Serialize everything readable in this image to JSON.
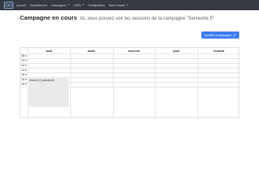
{
  "nav": {
    "logo": "logo-icon",
    "items": [
      {
        "label": "Accueil",
        "dropdown": false
      },
      {
        "label": "Compétences",
        "dropdown": false
      },
      {
        "label": "Campagnes",
        "dropdown": true
      },
      {
        "label": "UFRs",
        "dropdown": true
      },
      {
        "label": "Configuration",
        "dropdown": false
      },
      {
        "label": "Mon Compte",
        "dropdown": true
      }
    ]
  },
  "header": {
    "title": "Campagne en cours",
    "subtitle": "Ici, vous pouvez voir les sessions de la campagne \"Semestre 5\""
  },
  "edit_button": {
    "label": "Modifier la campagne",
    "icon": "pencil-icon"
  },
  "schedule": {
    "days": [
      "lundi",
      "mardi",
      "mercredi",
      "jeudi",
      "vendredi"
    ],
    "times": [
      "08 h",
      "10 h",
      "12 h",
      "14 h",
      "16 h",
      "18 h",
      "20 h"
    ],
    "sessions": [
      {
        "day": "lundi",
        "label": "Session (1 participant)"
      }
    ]
  },
  "colors": {
    "navbar": "#353a40",
    "primary": "#3d7bf0",
    "session_bg": "#e9eaec"
  }
}
